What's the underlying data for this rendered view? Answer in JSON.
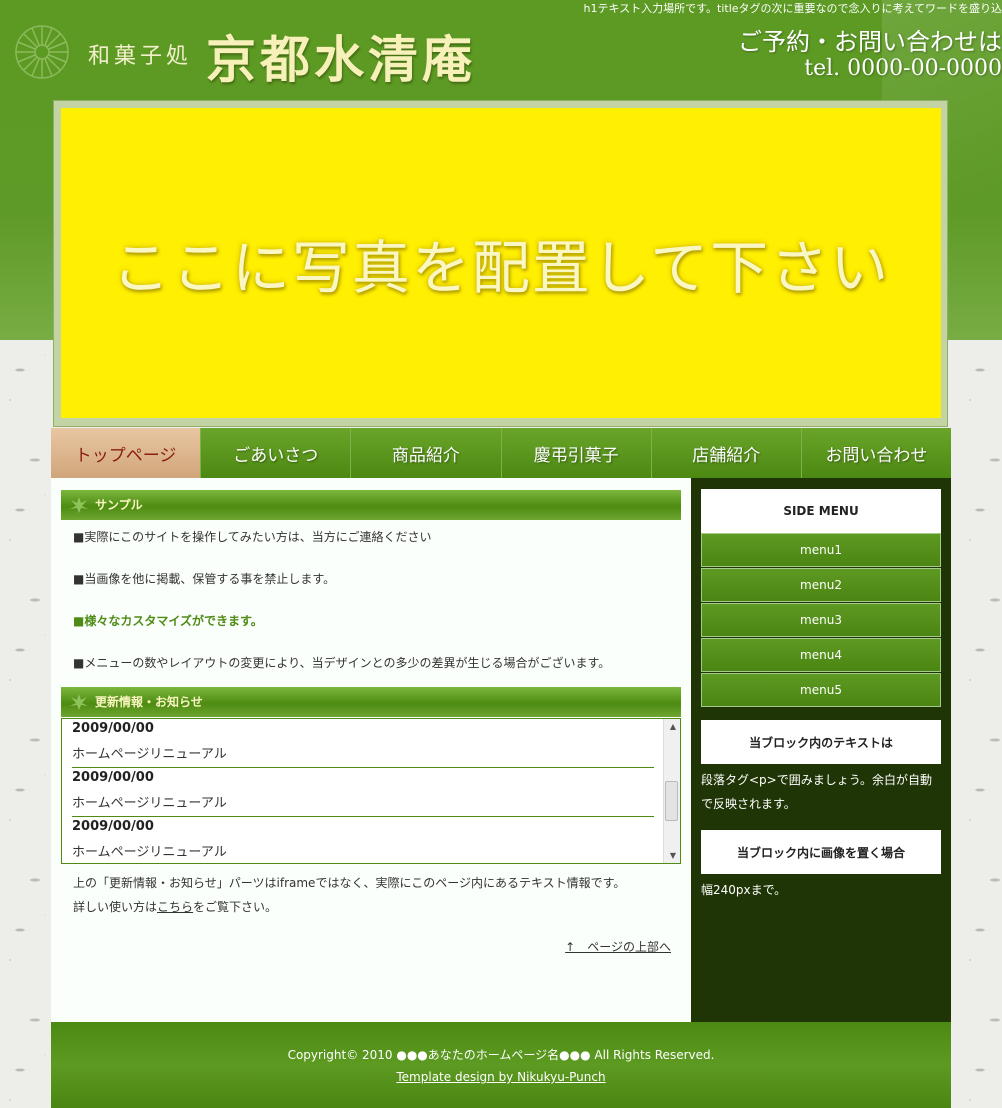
{
  "header": {
    "h1_text": "h1テキスト入力場所です。titleタグの次に重要なので念入りに考えてワードを盛り込",
    "logo_sub": "和菓子処",
    "logo_main": "京都水清庵",
    "contact_line1": "ご予約・お問い合わせは",
    "contact_line2": "tel. 0000-00-0000"
  },
  "hero": {
    "placeholder": "ここに写真を配置して下さい"
  },
  "nav": {
    "items": [
      {
        "label": "トップページ"
      },
      {
        "label": "ごあいさつ"
      },
      {
        "label": "商品紹介"
      },
      {
        "label": "慶弔引菓子"
      },
      {
        "label": "店舗紹介"
      },
      {
        "label": "お問い合わせ"
      }
    ]
  },
  "main": {
    "sample_heading": "サンプル",
    "paragraphs": [
      "■実際にこのサイトを操作してみたい方は、当方にご連絡ください",
      "■当画像を他に掲載、保管する事を禁止します。",
      "■様々なカスタマイズができます。",
      "■メニューの数やレイアウトの変更により、当デザインとの多少の差異が生じる場合がございます。"
    ],
    "news_heading": "更新情報・お知らせ",
    "news": [
      {
        "date": "2009/00/00",
        "title": "ホームページリニューアル"
      },
      {
        "date": "2009/00/00",
        "title": "ホームページリニューアル"
      },
      {
        "date": "2009/00/00",
        "title": "ホームページリニューアル"
      }
    ],
    "note_line1": "上の「更新情報・お知らせ」パーツはiframeではなく、実際にこのページ内にあるテキスト情報です。",
    "note_line2_pre": "詳しい使い方は",
    "note_link": "こちら",
    "note_line2_post": "をご覧下さい。",
    "to_top": "↑　ページの上部へ"
  },
  "side": {
    "menu_title": "SIDE MENU",
    "menu": [
      "menu1",
      "menu2",
      "menu3",
      "menu4",
      "menu5"
    ],
    "block1_title": "当ブロック内のテキストは",
    "block1_text": "段落タグ<p>で囲みましょう。余白が自動で反映されます。",
    "block2_title": "当ブロック内に画像を置く場合",
    "block2_text": "幅240pxまで。"
  },
  "footer": {
    "copyright": "Copyright© 2010 ●●●あなたのホームページ名●●● All Rights Reserved.",
    "credit": "Template design by Nikukyu-Punch"
  },
  "colors": {
    "brand_green": "#5c9a23",
    "hero_yellow": "#ffef00",
    "side_dark": "#203506"
  }
}
